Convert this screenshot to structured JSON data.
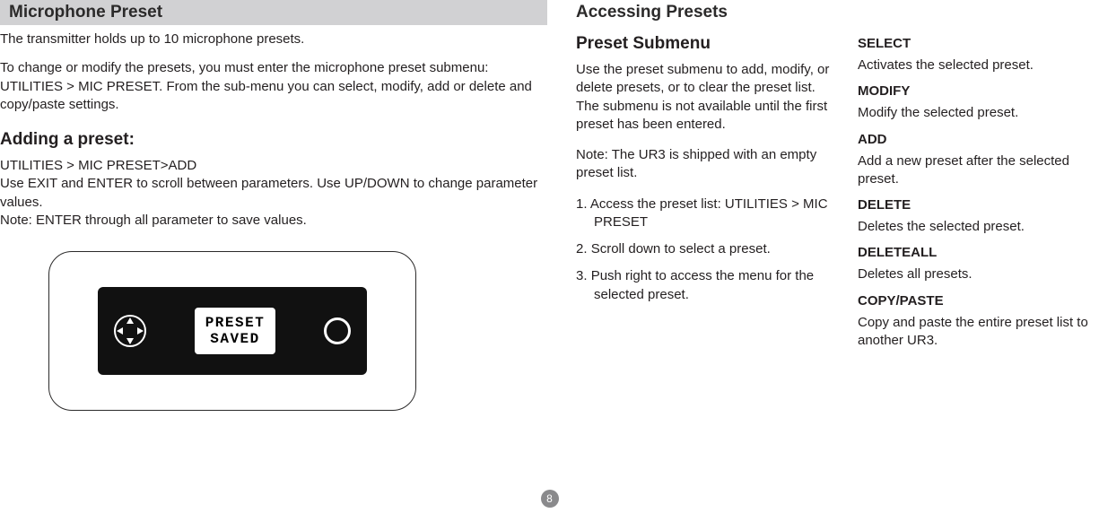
{
  "left": {
    "header": "Microphone Preset",
    "intro1": "The transmitter holds up to 10 microphone presets.",
    "intro2": "To change or modify the presets, you must enter the microphone preset submenu: UTILITIES > MIC PRESET. From the sub-menu you can select, modify, add or delete and copy/paste settings.",
    "adding_title": "Adding a preset:",
    "adding_path": "UTILITIES > MIC PRESET>ADD",
    "adding_instr": "Use EXIT and ENTER to scroll between parameters. Use UP/DOWN to change parameter values.",
    "adding_note": "Note: ENTER through all parameter to save values.",
    "device_line1": "PRESET",
    "device_line2": "SAVED"
  },
  "right": {
    "header": "Accessing Presets",
    "submenu_title": "Preset Submenu",
    "submenu_body": "Use the preset submenu to add, modify, or delete presets, or to clear the preset list. The submenu is not available until the first preset has been entered.",
    "submenu_note": "Note: The UR3 is shipped with an empty preset list.",
    "steps": [
      "Access the preset list: UTILITIES > MIC PRESET",
      "Scroll down to select a preset.",
      "Push right to access the menu for the selected preset."
    ],
    "commands": [
      {
        "term": "SELECT",
        "desc": "Activates the selected preset."
      },
      {
        "term": "MODIFY",
        "desc": "Modify the selected preset."
      },
      {
        "term": "ADD",
        "desc": "Add a new preset after the selected preset."
      },
      {
        "term": "DELETE",
        "desc": "Deletes the selected preset."
      },
      {
        "term": "DELETEALL",
        "desc": "Deletes all presets."
      },
      {
        "term": "COPY/PASTE",
        "desc": "Copy and paste the entire preset list to another UR3."
      }
    ]
  },
  "page_number": "8"
}
